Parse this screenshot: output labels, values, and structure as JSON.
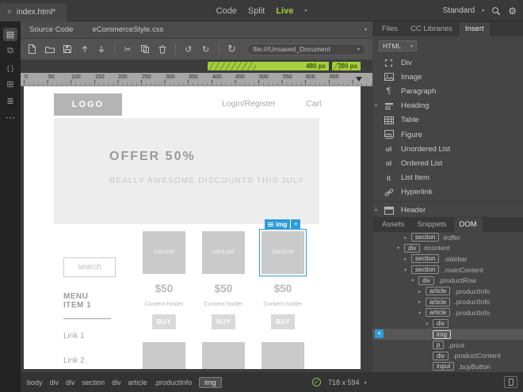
{
  "topbar": {
    "close": "×",
    "tab_title": "index.html*",
    "modes": {
      "code": "Code",
      "split": "Split",
      "live": "Live"
    },
    "workspace": "Standard"
  },
  "doc": {
    "related_files": [
      "Source Code",
      "eCommerceStyle.css"
    ],
    "address": "file:///Unsaved_Document",
    "media_queries": [
      {
        "label": "480 px"
      },
      {
        "label": "700 px"
      }
    ],
    "ruler_marks": [
      "0",
      "50",
      "100",
      "150",
      "200",
      "250",
      "300",
      "350",
      "400",
      "450",
      "500",
      "550",
      "600",
      "650"
    ]
  },
  "canvas": {
    "logo": "LOGO",
    "nav_login": "Login/Register",
    "nav_cart": "Cart",
    "offer_title": "OFFER 50%",
    "offer_subtitle": "REALLY AWESOME DISCOUNTS THIS JULY",
    "search_placeholder": "search",
    "menu_title": "MENU ITEM 1",
    "link1": "Link 1",
    "link2": "Link 2",
    "selection_badge": {
      "tag": "img",
      "add": "+"
    },
    "products": [
      {
        "image_label": "100X100",
        "price": "$50",
        "description": "Content holder",
        "buy": "BUY"
      },
      {
        "image_label": "100X100",
        "price": "$50",
        "description": "Content holder",
        "buy": "BUY"
      },
      {
        "image_label": "100X100",
        "price": "$50",
        "description": "Content holder",
        "buy": "BUY"
      }
    ]
  },
  "insert_panel": {
    "tabs": [
      "Files",
      "CC Libraries",
      "Insert"
    ],
    "active_tab": "Insert",
    "category": "HTML",
    "items": [
      {
        "icon": "div-icon",
        "label": "Div"
      },
      {
        "icon": "image-icon",
        "label": "Image"
      },
      {
        "icon": "paragraph-icon",
        "label": "Paragraph",
        "glyph": "¶"
      },
      {
        "icon": "heading-icon",
        "label": "Heading",
        "has_menu": true
      },
      {
        "icon": "table-icon",
        "label": "Table"
      },
      {
        "icon": "figure-icon",
        "label": "Figure"
      },
      {
        "icon": "unordered-list-icon",
        "label": "Unordered List",
        "glyph": "ul"
      },
      {
        "icon": "ordered-list-icon",
        "label": "Ordered List",
        "glyph": "ol"
      },
      {
        "icon": "list-item-icon",
        "label": "List Item",
        "glyph": "li"
      },
      {
        "icon": "hyperlink-icon",
        "label": "Hyperlink"
      },
      {
        "icon": "header-icon",
        "label": "Header",
        "has_menu": true
      }
    ]
  },
  "dom_panel": {
    "tabs": [
      "Assets",
      "Snippets",
      "DOM"
    ],
    "active_tab": "DOM",
    "tree": [
      {
        "tag": "section",
        "attr": "#offer",
        "state": "collapsed"
      },
      {
        "tag": "div",
        "attr": "#content",
        "state": "expanded"
      },
      {
        "tag": "section",
        "attr": ".sidebar",
        "state": "collapsed"
      },
      {
        "tag": "section",
        "attr": ".mainContent",
        "state": "expanded"
      },
      {
        "tag": "div",
        "attr": ".productRow",
        "state": "expanded"
      },
      {
        "tag": "article",
        "attr": ".productInfo",
        "state": "collapsed"
      },
      {
        "tag": "article",
        "attr": ".productInfo",
        "state": "collapsed"
      },
      {
        "tag": "article",
        "attr": ".productInfo",
        "state": "expanded"
      },
      {
        "tag": "div",
        "attr": "",
        "state": "expanded"
      },
      {
        "tag": "img",
        "attr": "",
        "state": "leaf",
        "selected": true,
        "add": "+"
      },
      {
        "tag": "p",
        "attr": ".price",
        "state": "leaf"
      },
      {
        "tag": "div",
        "attr": ".productContent",
        "state": "leaf"
      },
      {
        "tag": "input",
        "attr": ".buyButton",
        "state": "leaf"
      }
    ]
  },
  "statusbar": {
    "tag_path": [
      "body",
      "div",
      "div",
      "section",
      "div",
      "article",
      ".productInfo",
      "img"
    ],
    "selected_tag": "img",
    "size": "718 x 594"
  },
  "colors": {
    "accent_green": "#a5cf3e",
    "selection_blue": "#2f9bd8",
    "lint_ok_green": "#8cc152"
  }
}
